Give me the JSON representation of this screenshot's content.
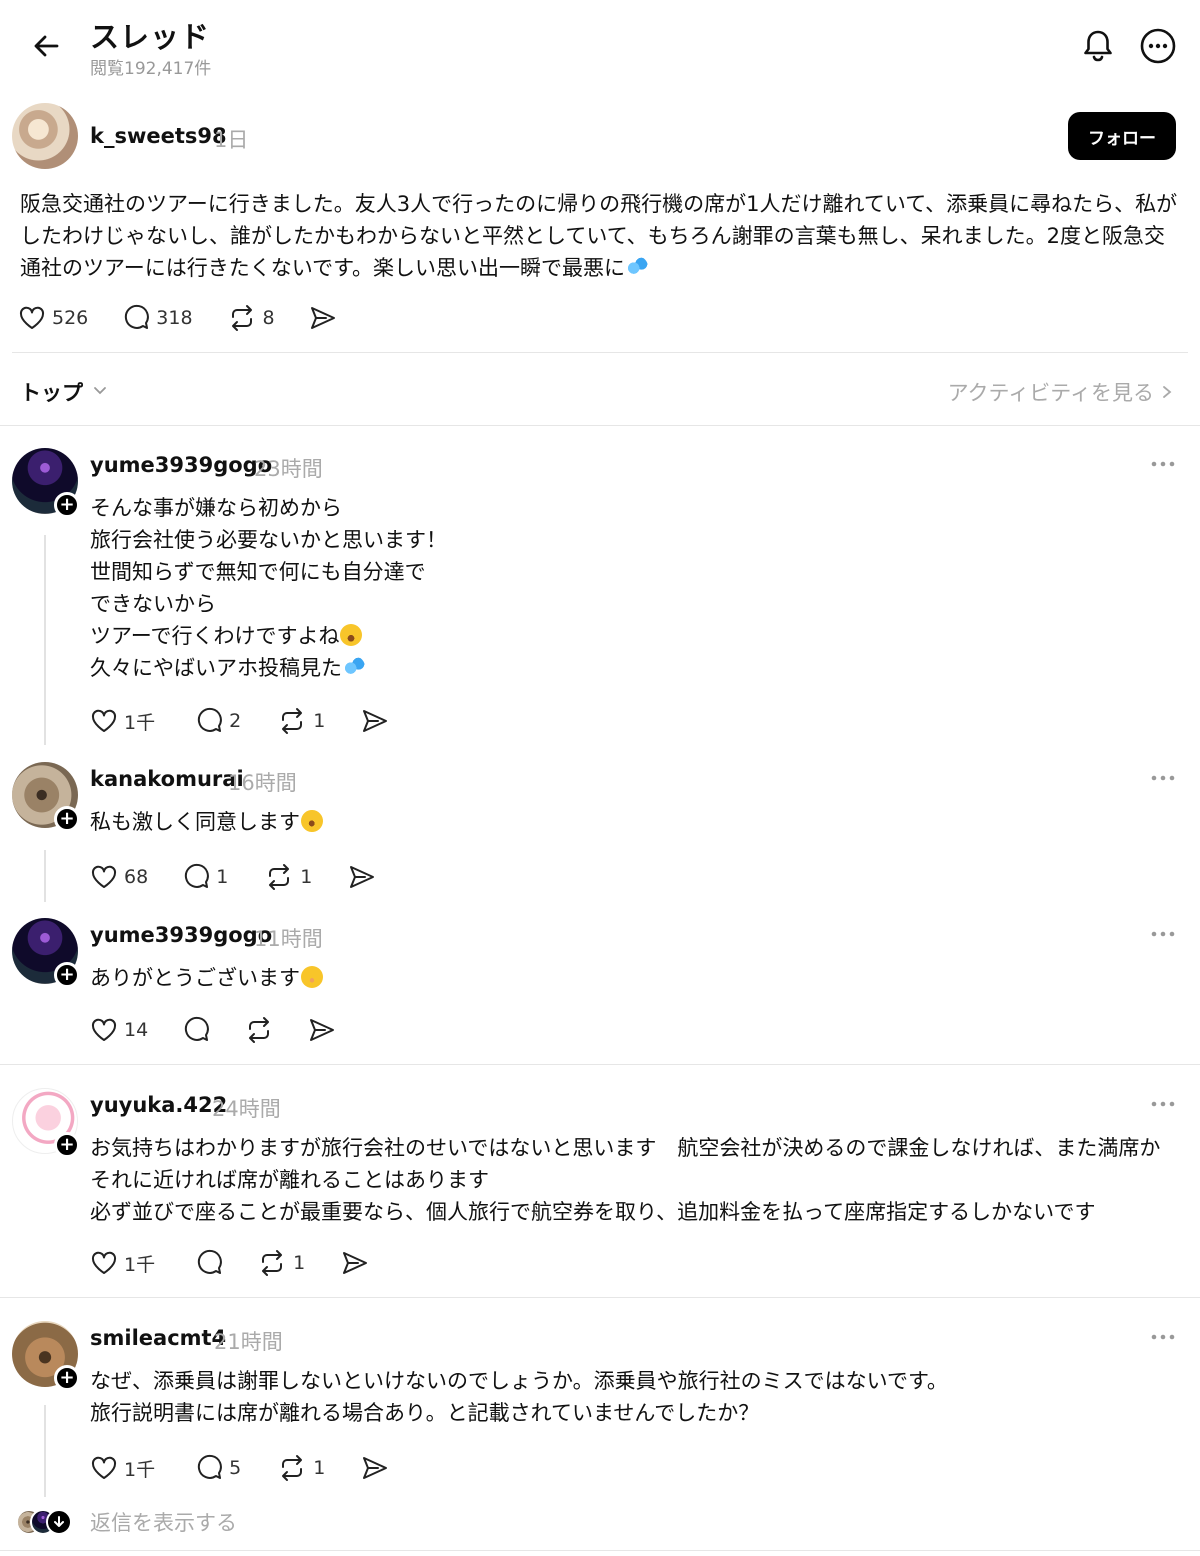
{
  "header": {
    "title": "スレッド",
    "views": "閲覧192,417件"
  },
  "post": {
    "username": "k_sweets98",
    "time": "1日",
    "follow_label": "フォロー",
    "body": "阪急交通社のツアーに行きました。友人3人で行ったのに帰りの飛行機の席が1人だけ離れていて、添乗員に尋ねたら、私がしたわけじゃないし、誰がしたかもわからないと平然としていて、もちろん謝罪の言葉も無し、呆れました。2度と阪急交通社のツアーには行きたくないです。楽しい思い出一瞬で最悪に",
    "likes": "526",
    "replies": "318",
    "reposts": "8"
  },
  "sort": {
    "label": "トップ",
    "activity_link": "アクティビティを見る"
  },
  "comments": [
    {
      "username": "yume3939gogo",
      "time": "23時間",
      "text": "そんな事が嫌なら初めから\n旅行会社使う必要ないかと思います！\n世間知らずで無知で何にも自分達で\nできないから\nツアーで行くわけですよね",
      "text_tail": "久々にやばいアホ投稿見た",
      "likes": "1千",
      "replies": "2",
      "reposts": "1"
    },
    {
      "username": "kanakomurai",
      "time": "16時間",
      "text": "私も激しく同意します",
      "likes": "68",
      "replies": "1",
      "reposts": "1"
    },
    {
      "username": "yume3939gogo",
      "time": "11時間",
      "text": "ありがとうございます",
      "likes": "14",
      "replies": "",
      "reposts": ""
    },
    {
      "username": "yuyuka.422",
      "time": "24時間",
      "text": "お気持ちはわかりますが旅行会社のせいではないと思います　航空会社が決めるので課金しなければ、また満席かそれに近ければ席が離れることはあります\n必ず並びで座ることが最重要なら、個人旅行で航空券を取り、追加料金を払って座席指定するしかないです",
      "likes": "1千",
      "replies": "",
      "reposts": "1"
    },
    {
      "username": "smileacmt4",
      "time": "21時間",
      "text": "なぜ、添乗員は謝罪しないといけないのでしょうか。添乗員や旅行社のミスではないです。\n旅行説明書には席が離れる場合あり。と記載されていませんでしたか？",
      "likes": "1千",
      "replies": "5",
      "reposts": "1"
    }
  ],
  "show_replies_label": "返信を表示する"
}
